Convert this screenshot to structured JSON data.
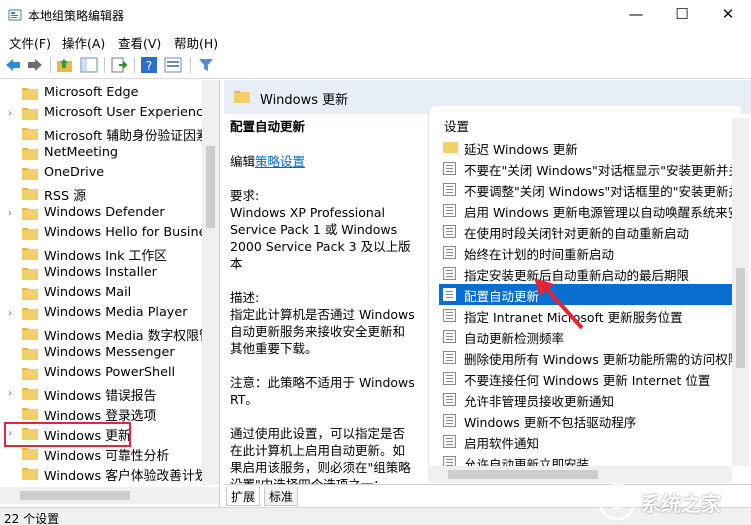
{
  "window": {
    "title": "本地组策略编辑器",
    "min": "—",
    "max": "☐",
    "close": "✕"
  },
  "menu": [
    "文件(F)",
    "操作(A)",
    "查看(V)",
    "帮助(H)"
  ],
  "tree": [
    {
      "label": "Microsoft Edge",
      "expandable": false
    },
    {
      "label": "Microsoft User Experience",
      "expandable": true
    },
    {
      "label": "Microsoft 辅助身份验证因素",
      "expandable": false
    },
    {
      "label": "NetMeeting",
      "expandable": false
    },
    {
      "label": "OneDrive",
      "expandable": false
    },
    {
      "label": "RSS 源",
      "expandable": false
    },
    {
      "label": "Windows Defender",
      "expandable": true
    },
    {
      "label": "Windows Hello for Busines",
      "expandable": false
    },
    {
      "label": "Windows Ink 工作区",
      "expandable": false
    },
    {
      "label": "Windows Installer",
      "expandable": false
    },
    {
      "label": "Windows Mail",
      "expandable": false
    },
    {
      "label": "Windows Media Player",
      "expandable": true
    },
    {
      "label": "Windows Media 数字权限管",
      "expandable": false
    },
    {
      "label": "Windows Messenger",
      "expandable": false
    },
    {
      "label": "Windows PowerShell",
      "expandable": false
    },
    {
      "label": "Windows 错误报告",
      "expandable": true
    },
    {
      "label": "Windows 登录选项",
      "expandable": false
    },
    {
      "label": "Windows 更新",
      "expandable": true,
      "selected": true
    },
    {
      "label": "Windows 可靠性分析",
      "expandable": false
    },
    {
      "label": "Windows 客户体验改善计划",
      "expandable": false
    }
  ],
  "right_header": "Windows 更新",
  "desc": {
    "title": "配置自动更新",
    "edit_prefix": "编辑",
    "edit_link": "策略设置",
    "req_label": "要求:",
    "req_text": "Windows XP Professional Service Pack 1 或 Windows 2000 Service Pack 3 及以上版本",
    "desc_label": "描述:",
    "desc_text": "指定此计算机是否通过 Windows 自动更新服务来接收安全更新和其他重要下载。",
    "note": "注意：此策略不适用于 Windows RT。",
    "usage": "通过使用此设置，可以指定是否在此计算机上启用自动更新。如果启用该服务，则必须在\"组策略设置\"中选择四个选项之一："
  },
  "list": {
    "column": "设置",
    "rows": [
      {
        "label": "延迟 Windows 更新",
        "folder": true
      },
      {
        "label": "不要在\"关闭 Windows\"对话框显示\"安装更新并关"
      },
      {
        "label": "不要调整\"关闭 Windows\"对话框里的\"安装更新并关"
      },
      {
        "label": "启用 Windows 更新电源管理以自动唤醒系统来安装"
      },
      {
        "label": "在使用时段关闭针对更新的自动重新启动"
      },
      {
        "label": "始终在计划的时间重新启动"
      },
      {
        "label": "指定安装更新后自动重新启动的最后期限"
      },
      {
        "label": "配置自动更新",
        "highlight": true
      },
      {
        "label": "指定 Intranet Microsoft 更新服务位置"
      },
      {
        "label": "自动更新检测频率"
      },
      {
        "label": "删除使用所有 Windows 更新功能所需的访问权限"
      },
      {
        "label": "不要连接任何 Windows 更新 Internet 位置"
      },
      {
        "label": "允许非管理员接收更新通知"
      },
      {
        "label": "Windows 更新不包括驱动程序"
      },
      {
        "label": "启用软件通知"
      },
      {
        "label": "允许自动更新立即安装"
      }
    ]
  },
  "tabs": [
    "扩展",
    "标准"
  ],
  "status": "22 个设置",
  "watermark": "系统之家",
  "colors": {
    "selection": "#0a6ed1",
    "red_box": "#e0263a",
    "link": "#0066cc"
  }
}
